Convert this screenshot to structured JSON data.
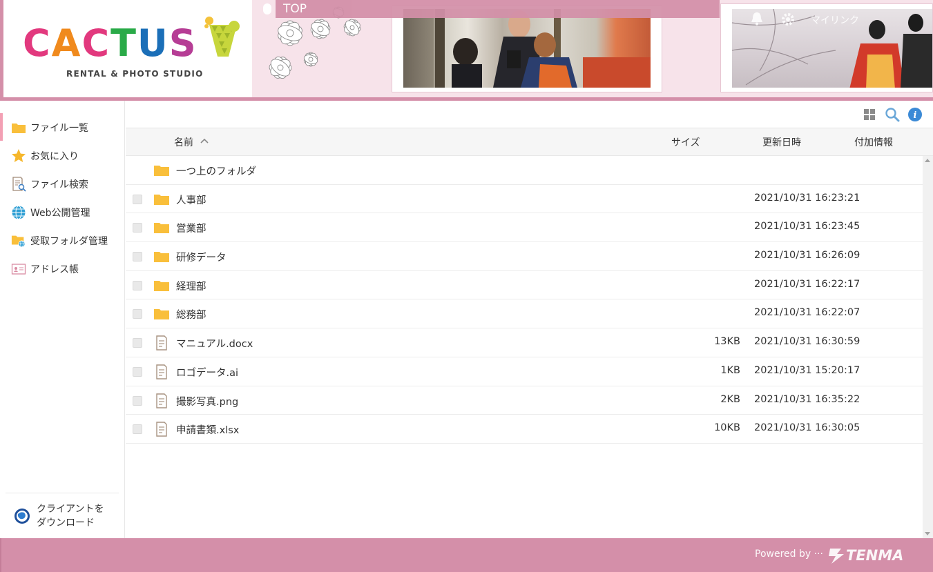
{
  "brand": {
    "logo_letters": [
      "C",
      "A",
      "C",
      "T",
      "U",
      "S"
    ],
    "logo_colors": [
      "#e2397e",
      "#f08a1d",
      "#e2397e",
      "#2aaa48",
      "#1b6fb8",
      "#b63d95"
    ],
    "subtitle": "RENTAL & PHOTO STUDIO"
  },
  "header": {
    "top_label": "TOP",
    "mylink_label": "マイリンク",
    "accent_color": "#d48fa9"
  },
  "sidebar": {
    "items": [
      {
        "label": "ファイル一覧",
        "icon": "folder-icon",
        "active": true
      },
      {
        "label": "お気に入り",
        "icon": "star-icon"
      },
      {
        "label": "ファイル検索",
        "icon": "file-search-icon"
      },
      {
        "label": "Web公開管理",
        "icon": "globe-icon"
      },
      {
        "label": "受取フォルダ管理",
        "icon": "folder-globe-icon"
      },
      {
        "label": "アドレス帳",
        "icon": "address-book-icon"
      }
    ],
    "client_download": {
      "line1": "クライアントを",
      "line2": "ダウンロード"
    }
  },
  "toolbar": {
    "icons": [
      "grid-view-icon",
      "search-icon",
      "info-icon"
    ]
  },
  "table": {
    "columns": {
      "name": "名前",
      "size": "サイズ",
      "updated": "更新日時",
      "extra": "付加情報"
    },
    "sort_indicator": "^",
    "parent_folder": "一つ上のフォルダ",
    "rows": [
      {
        "type": "folder",
        "name": "人事部",
        "size": "",
        "updated": "2021/10/31 16:23:21"
      },
      {
        "type": "folder",
        "name": "営業部",
        "size": "",
        "updated": "2021/10/31 16:23:45"
      },
      {
        "type": "folder",
        "name": "研修データ",
        "size": "",
        "updated": "2021/10/31 16:26:09"
      },
      {
        "type": "folder",
        "name": "経理部",
        "size": "",
        "updated": "2021/10/31 16:22:17"
      },
      {
        "type": "folder",
        "name": "総務部",
        "size": "",
        "updated": "2021/10/31 16:22:07"
      },
      {
        "type": "file",
        "name": "マニュアル.docx",
        "size": "13KB",
        "updated": "2021/10/31 16:30:59"
      },
      {
        "type": "file",
        "name": "ロゴデータ.ai",
        "size": "1KB",
        "updated": "2021/10/31 15:20:17"
      },
      {
        "type": "file",
        "name": "撮影写真.png",
        "size": "2KB",
        "updated": "2021/10/31 16:35:22"
      },
      {
        "type": "file",
        "name": "申請書類.xlsx",
        "size": "10KB",
        "updated": "2021/10/31 16:30:05"
      }
    ]
  },
  "footer": {
    "powered_by": "Powered by ···",
    "vendor": "TENMA"
  }
}
